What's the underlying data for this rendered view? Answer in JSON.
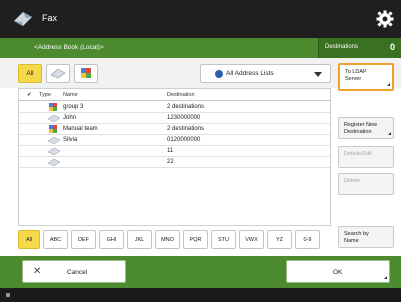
{
  "header": {
    "title": "Fax",
    "app_icon": "fax-icon",
    "settings_icon": "gear-icon"
  },
  "breadcrumb": {
    "label": "<Address Book (Local)>"
  },
  "destinations": {
    "label": "Destinations",
    "count": "0"
  },
  "filters": {
    "all_label": "All",
    "person_icon": "person-icon",
    "group_icon": "group-icon"
  },
  "address_list": {
    "selected": "All Address Lists",
    "icon": "globe-icon"
  },
  "list": {
    "headers": {
      "check": "✔",
      "type": "Type",
      "name": "Name",
      "destination": "Destination"
    },
    "rows": [
      {
        "icon": "group-icon",
        "name": "group 3",
        "destination": "2 destinations"
      },
      {
        "icon": "person-icon",
        "name": "John",
        "destination": "1230000000"
      },
      {
        "icon": "group-icon",
        "name": "Manual team",
        "destination": "2 destinations"
      },
      {
        "icon": "person-icon",
        "name": "Silvia",
        "destination": "0120000000"
      },
      {
        "icon": "person-icon",
        "name": "",
        "destination": "11"
      },
      {
        "icon": "person-icon",
        "name": "",
        "destination": "22"
      }
    ]
  },
  "side_buttons": {
    "ldap": "To LDAP\nServer",
    "register": "Register New\nDestination",
    "details": "Details/Edit",
    "delete": "Delete",
    "search": "Search by\nName"
  },
  "alphabet": [
    "All",
    "ABC",
    "DEF",
    "GHI",
    "JKL",
    "MNO",
    "PQR",
    "STU",
    "VWX",
    "YZ",
    "0-9"
  ],
  "footer_buttons": {
    "cancel": "Cancel",
    "cancel_icon": "close-icon",
    "ok": "OK"
  },
  "colors": {
    "green": "#4c8a2f",
    "dark": "#1f1f1f",
    "yellow": "#f6d84b",
    "highlight": "#f0a02c"
  }
}
